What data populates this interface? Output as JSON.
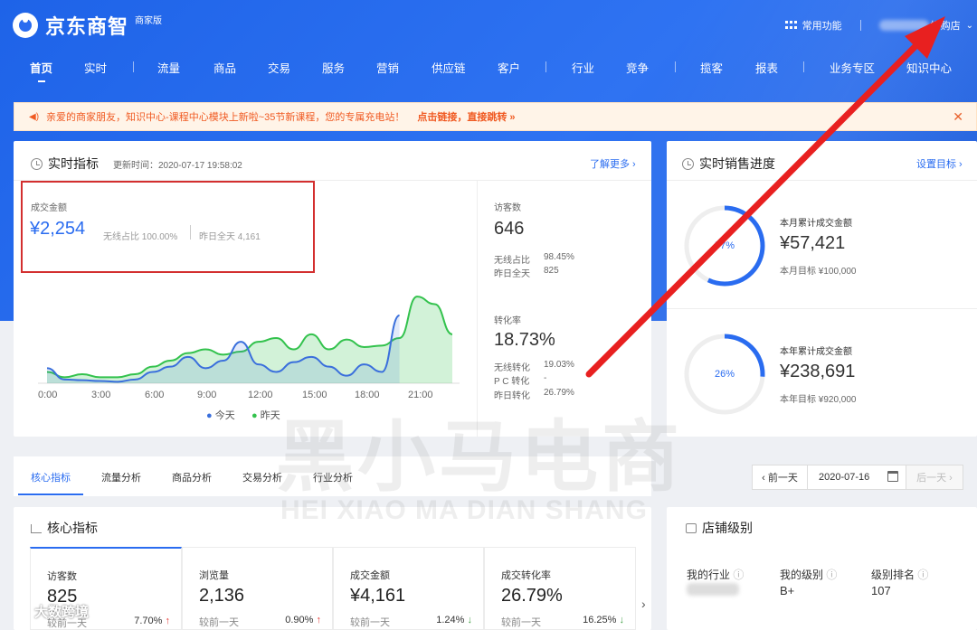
{
  "header": {
    "logo_text": "京东商智",
    "logo_sub": "商家版",
    "common_functions": "常用功能",
    "store_suffix": "拼购店"
  },
  "nav": [
    "首页",
    "实时",
    "流量",
    "商品",
    "交易",
    "服务",
    "营销",
    "供应链",
    "客户",
    "行业",
    "竞争",
    "揽客",
    "报表",
    "业务专区",
    "知识中心"
  ],
  "notice": {
    "text": "亲爱的商家朋友，知识中心-课程中心模块上新啦~35节新课程，您的专属充电站！",
    "link": "点击链接，直接跳转 »",
    "close": "✕"
  },
  "realtime": {
    "title": "实时指标",
    "updated": "更新时间：2020-07-17 19:58:02",
    "more": "了解更多 ›",
    "gmv_label": "成交金额",
    "gmv_value": "¥2,254",
    "wireless_ratio": "无线占比 100.00%",
    "yesterday_full": "昨日全天 4,161",
    "visitors_label": "访客数",
    "visitors_value": "646",
    "visitors_wireless_label": "无线占比",
    "visitors_wireless_value": "98.45%",
    "visitors_yesterday_label": "昨日全天",
    "visitors_yesterday_value": "825",
    "conv_label": "转化率",
    "conv_value": "18.73%",
    "conv_wireless_label": "无线转化",
    "conv_wireless_value": "19.03%",
    "conv_pc_label": "P C 转化",
    "conv_pc_value": "-",
    "conv_yesterday_label": "昨日转化",
    "conv_yesterday_value": "26.79%",
    "legend_today": "今天",
    "legend_yesterday": "昨天"
  },
  "chart_data": {
    "type": "area",
    "x_ticks": [
      "0:00",
      "3:00",
      "6:00",
      "9:00",
      "12:00",
      "15:00",
      "18:00",
      "21:00"
    ],
    "x": [
      0,
      1,
      2,
      3,
      4,
      5,
      6,
      7,
      8,
      9,
      10,
      11,
      12,
      13,
      14,
      15,
      16,
      17,
      18,
      19,
      20,
      21,
      22,
      23
    ],
    "series": [
      {
        "name": "今天",
        "color": "#3a6fdc",
        "values": [
          2,
          0.5,
          0.4,
          0.3,
          0.2,
          0.5,
          1.5,
          2.2,
          3.5,
          2.0,
          3.0,
          5.5,
          2.5,
          1.5,
          2.8,
          3.5,
          2.2,
          1.0,
          2.5,
          1.5,
          9.0
        ]
      },
      {
        "name": "昨天",
        "color": "#33c24d",
        "values": [
          1.5,
          0.8,
          1.2,
          0.8,
          0.8,
          1.2,
          2.2,
          3.0,
          4.0,
          4.5,
          3.8,
          4.2,
          5.5,
          6.0,
          4.5,
          6.5,
          4.5,
          5.8,
          4.8,
          5.0,
          6.0,
          11.5,
          10.5,
          6.5
        ]
      }
    ]
  },
  "sales_progress": {
    "title": "实时销售进度",
    "set_target": "设置目标 ›",
    "month_label": "本月累计成交金额",
    "month_value": "¥57,421",
    "month_target": "本月目标 ¥100,000",
    "month_pct": "57%",
    "month_fraction": 0.57,
    "year_label": "本年累计成交金额",
    "year_value": "¥238,691",
    "year_target": "本年目标 ¥920,000",
    "year_pct": "26%",
    "year_fraction": 0.26,
    "ring_color": "#2a6cf0"
  },
  "tabs": [
    "核心指标",
    "流量分析",
    "商品分析",
    "交易分析",
    "行业分析"
  ],
  "date_picker": {
    "prev": "‹ 前一天",
    "date": "2020-07-16",
    "next": "后一天 ›"
  },
  "core": {
    "title": "核心指标",
    "kpis": [
      {
        "label": "访客数",
        "value": "825",
        "cmp": "较前一天",
        "pct": "7.70%",
        "dir": "up"
      },
      {
        "label": "浏览量",
        "value": "2,136",
        "cmp": "较前一天",
        "pct": "0.90%",
        "dir": "up"
      },
      {
        "label": "成交金额",
        "value": "¥4,161",
        "cmp": "较前一天",
        "pct": "1.24%",
        "dir": "down"
      },
      {
        "label": "成交转化率",
        "value": "26.79%",
        "cmp": "较前一天",
        "pct": "16.25%",
        "dir": "down"
      }
    ]
  },
  "store_level": {
    "title": "店铺级别",
    "industry_label": "我的行业",
    "level_label": "我的级别",
    "level_value": "B+",
    "rank_label": "级别排名",
    "rank_value": "107"
  },
  "watermark": {
    "cn": "黑小马电商",
    "en": "HEI XIAO MA DIAN SHANG",
    "corner": "大数跨境"
  }
}
